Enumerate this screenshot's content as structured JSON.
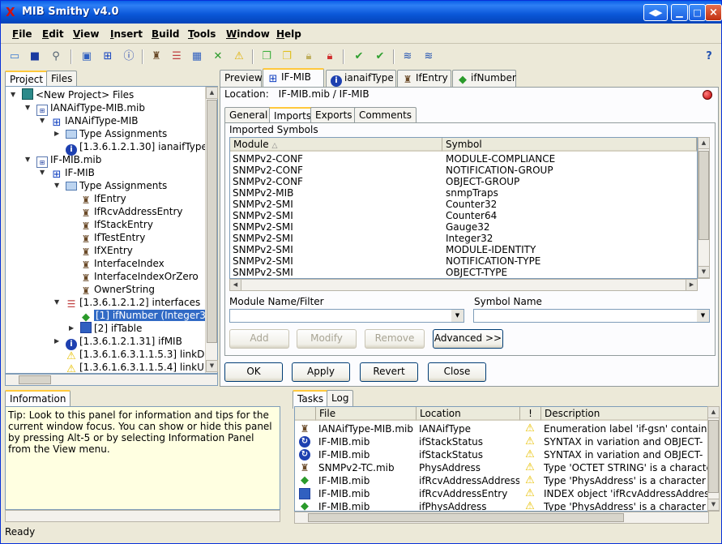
{
  "window": {
    "title": "MIB Smithy v4.0"
  },
  "menu": [
    "File",
    "Edit",
    "View",
    "Insert",
    "Build",
    "Tools",
    "Window",
    "Help"
  ],
  "left_tabs": [
    "Project",
    "Files"
  ],
  "tree": [
    {
      "label": "<New Project> Files",
      "icon": "project-icon",
      "level": 0,
      "exp": "▼"
    },
    {
      "label": "IANAifType-MIB.mib",
      "icon": "mib-file-icon",
      "level": 1,
      "exp": "▼"
    },
    {
      "label": "IANAifType-MIB",
      "icon": "module-icon",
      "level": 2,
      "exp": "▼"
    },
    {
      "label": "Type Assignments",
      "icon": "folder-icon",
      "level": 3,
      "exp": "▶"
    },
    {
      "label": "[1.3.6.1.2.1.30] ianaifType",
      "icon": "info-icon",
      "level": 3,
      "exp": ""
    },
    {
      "label": "IF-MIB.mib",
      "icon": "mib-file-icon",
      "level": 1,
      "exp": "▼"
    },
    {
      "label": "IF-MIB",
      "icon": "module-icon",
      "level": 2,
      "exp": "▼"
    },
    {
      "label": "Type Assignments",
      "icon": "folder-icon",
      "level": 3,
      "exp": "▼"
    },
    {
      "label": "IfEntry",
      "icon": "type-icon",
      "level": 4,
      "exp": ""
    },
    {
      "label": "IfRcvAddressEntry",
      "icon": "type-icon",
      "level": 4,
      "exp": ""
    },
    {
      "label": "IfStackEntry",
      "icon": "type-icon",
      "level": 4,
      "exp": ""
    },
    {
      "label": "IfTestEntry",
      "icon": "type-icon",
      "level": 4,
      "exp": ""
    },
    {
      "label": "IfXEntry",
      "icon": "type-icon",
      "level": 4,
      "exp": ""
    },
    {
      "label": "InterfaceIndex",
      "icon": "type-icon",
      "level": 4,
      "exp": ""
    },
    {
      "label": "InterfaceIndexOrZero",
      "icon": "type-icon",
      "level": 4,
      "exp": ""
    },
    {
      "label": "OwnerString",
      "icon": "type-icon",
      "level": 4,
      "exp": ""
    },
    {
      "label": "[1.3.6.1.2.1.2] interfaces",
      "icon": "tree-icon",
      "level": 3,
      "exp": "▼"
    },
    {
      "label": "[1] ifNumber (Integer32)",
      "icon": "scalar-icon",
      "level": 4,
      "exp": "",
      "selected": true
    },
    {
      "label": "[2] ifTable",
      "icon": "table-icon",
      "level": 4,
      "exp": "▶"
    },
    {
      "label": "[1.3.6.1.2.1.31] ifMIB",
      "icon": "info-icon",
      "level": 3,
      "exp": "▶"
    },
    {
      "label": "[1.3.6.1.6.3.1.1.5.3] linkDow",
      "icon": "warning-icon",
      "level": 3,
      "exp": ""
    },
    {
      "label": "[1.3.6.1.6.3.1.1.5.4] linkUp",
      "icon": "warning-icon",
      "level": 3,
      "exp": ""
    }
  ],
  "editor_tabs": [
    {
      "label": "Preview",
      "icon": ""
    },
    {
      "label": "IF-MIB",
      "icon": "module-icon",
      "active": true
    },
    {
      "label": "ianaifType",
      "icon": "info-icon"
    },
    {
      "label": "IfEntry",
      "icon": "type-icon"
    },
    {
      "label": "ifNumber",
      "icon": "scalar-icon"
    }
  ],
  "location": {
    "label": "Location:",
    "value": "IF-MIB.mib  /  IF-MIB"
  },
  "sub_tabs": [
    "General",
    "Imports",
    "Exports",
    "Comments"
  ],
  "imports": {
    "group_label": "Imported Symbols",
    "headers": [
      "Module",
      "Symbol"
    ],
    "rows": [
      [
        "SNMPv2-CONF",
        "MODULE-COMPLIANCE"
      ],
      [
        "SNMPv2-CONF",
        "NOTIFICATION-GROUP"
      ],
      [
        "SNMPv2-CONF",
        "OBJECT-GROUP"
      ],
      [
        "SNMPv2-MIB",
        "snmpTraps"
      ],
      [
        "SNMPv2-SMI",
        "Counter32"
      ],
      [
        "SNMPv2-SMI",
        "Counter64"
      ],
      [
        "SNMPv2-SMI",
        "Gauge32"
      ],
      [
        "SNMPv2-SMI",
        "Integer32"
      ],
      [
        "SNMPv2-SMI",
        "MODULE-IDENTITY"
      ],
      [
        "SNMPv2-SMI",
        "NOTIFICATION-TYPE"
      ],
      [
        "SNMPv2-SMI",
        "OBJECT-TYPE"
      ]
    ],
    "filter_label": "Module Name/Filter",
    "symbol_label": "Symbol Name",
    "add": "Add",
    "modify": "Modify",
    "remove": "Remove",
    "advanced": "Advanced >>"
  },
  "dialog_buttons": {
    "ok": "OK",
    "apply": "Apply",
    "revert": "Revert",
    "close": "Close"
  },
  "info": {
    "tab": "Information",
    "text": "Tip: Look to this panel for information and tips for the current window focus.  You can show or hide this panel by pressing Alt-5 or by selecting Information Panel from the View menu."
  },
  "tasks": {
    "tabs": [
      "Tasks",
      "Log"
    ],
    "headers": [
      "File",
      "Location",
      "!",
      "Description"
    ],
    "rows": [
      {
        "icon": "type-icon",
        "file": "IANAifType-MIB.mib",
        "location": "IANAifType",
        "desc": "Enumeration label 'if-gsn' contains"
      },
      {
        "icon": "sync-icon",
        "file": "IF-MIB.mib",
        "location": "ifStackStatus",
        "desc": "SYNTAX in variation and OBJECT-"
      },
      {
        "icon": "sync-icon",
        "file": "IF-MIB.mib",
        "location": "ifStackStatus",
        "desc": "SYNTAX in variation and OBJECT-"
      },
      {
        "icon": "type-icon",
        "file": "SNMPv2-TC.mib",
        "location": "PhysAddress",
        "desc": "Type 'OCTET STRING' is a characte"
      },
      {
        "icon": "scalar-icon",
        "file": "IF-MIB.mib",
        "location": "ifRcvAddressAddress",
        "desc": "Type 'PhysAddress' is a character s"
      },
      {
        "icon": "table-icon",
        "file": "IF-MIB.mib",
        "location": "ifRcvAddressEntry",
        "desc": "INDEX object 'ifRcvAddressAddress"
      },
      {
        "icon": "scalar-icon",
        "file": "IF-MIB.mib",
        "location": "ifPhysAddress",
        "desc": "Type 'PhysAddress' is a character s"
      }
    ]
  },
  "status": "Ready"
}
